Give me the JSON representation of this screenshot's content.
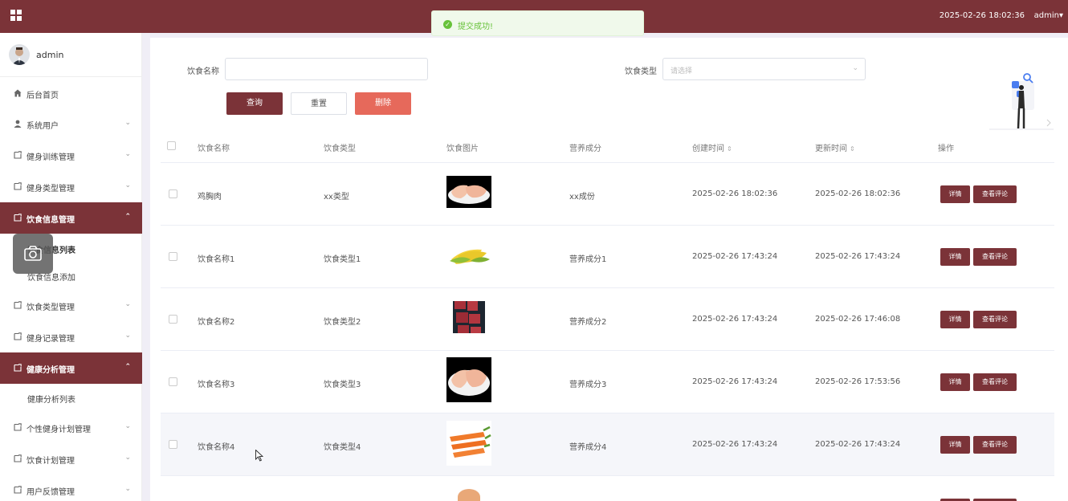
{
  "header": {
    "datetime": "2025-02-26 18:02:36",
    "user": "admin",
    "user_caret": "▾"
  },
  "toast": {
    "message": "提交成功!"
  },
  "sidebar": {
    "profile_name": "admin",
    "items": [
      {
        "label": "后台首页",
        "arrow": ""
      },
      {
        "label": "系统用户",
        "arrow": "⌄"
      },
      {
        "label": "健身训练管理",
        "arrow": "⌄"
      },
      {
        "label": "健身类型管理",
        "arrow": "⌄"
      },
      {
        "label": "饮食信息管理",
        "arrow": "⌃"
      },
      {
        "label": "饮食类型管理",
        "arrow": "⌄"
      },
      {
        "label": "健身记录管理",
        "arrow": "⌄"
      },
      {
        "label": "健康分析管理",
        "arrow": "⌃"
      },
      {
        "label": "个性健身计划管理",
        "arrow": "⌄"
      },
      {
        "label": "饮食计划管理",
        "arrow": "⌄"
      },
      {
        "label": "用户反馈管理",
        "arrow": "⌄"
      }
    ],
    "sub_items": {
      "diet_list": "饮食信息列表",
      "diet_add": "饮食信息添加",
      "health_list": "健康分析列表"
    }
  },
  "search": {
    "name_label": "饮食名称",
    "name_value": "",
    "type_label": "饮食类型",
    "type_placeholder": "请选择",
    "query_btn": "查询",
    "reset_btn": "重置",
    "delete_btn": "删除"
  },
  "table": {
    "headers": [
      "饮食名称",
      "饮食类型",
      "饮食图片",
      "营养成分",
      "创建时间",
      "更新时间",
      "操作"
    ],
    "sort_icon": "⇕",
    "detail_btn": "详情",
    "comment_btn": "查看评论",
    "rows": [
      {
        "name": "鸡胸肉",
        "type": "xx类型",
        "image": "chicken-breast",
        "nutrition": "xx成份",
        "created": "2025-02-26 18:02:36",
        "updated": "2025-02-26 18:02:36"
      },
      {
        "name": "饮食名称1",
        "type": "饮食类型1",
        "image": "corn",
        "nutrition": "营养成分1",
        "created": "2025-02-26 17:43:24",
        "updated": "2025-02-26 17:43:24"
      },
      {
        "name": "饮食名称2",
        "type": "饮食类型2",
        "image": "beef-cubes",
        "nutrition": "营养成分2",
        "created": "2025-02-26 17:43:24",
        "updated": "2025-02-26 17:46:08"
      },
      {
        "name": "饮食名称3",
        "type": "饮食类型3",
        "image": "chicken-breast",
        "nutrition": "营养成分3",
        "created": "2025-02-26 17:43:24",
        "updated": "2025-02-26 17:53:56"
      },
      {
        "name": "饮食名称4",
        "type": "饮食类型4",
        "image": "carrots",
        "nutrition": "营养成分4",
        "created": "2025-02-26 17:43:24",
        "updated": "2025-02-26 17:43:24"
      }
    ]
  },
  "colors": {
    "brand": "#7b3338",
    "danger": "#e6695b",
    "success": "#67c23a"
  }
}
